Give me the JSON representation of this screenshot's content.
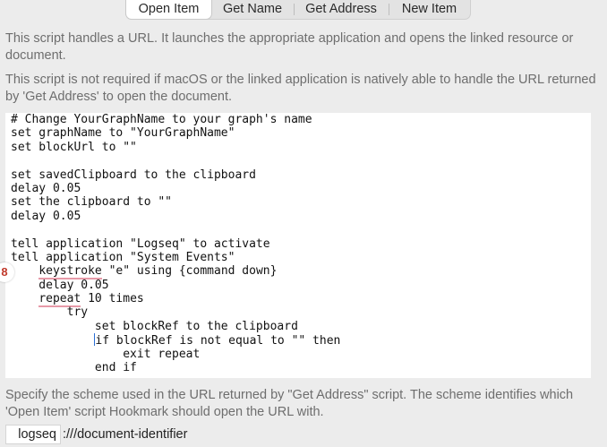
{
  "tabs": [
    {
      "label": "Open Item",
      "active": true
    },
    {
      "label": "Get Name",
      "active": false
    },
    {
      "label": "Get Address",
      "active": false
    },
    {
      "label": "New Item",
      "active": false
    }
  ],
  "description_1": "This script handles a URL. It launches the appropriate application and opens the linked resource or document.",
  "description_2": "This script is not required if macOS or the linked application is natively able to handle the URL returned by 'Get Address' to open the document.",
  "code_lines": [
    "# Change YourGraphName to your graph's name",
    "set graphName to \"YourGraphName\"",
    "set blockUrl to \"\"",
    "",
    "set savedClipboard to the clipboard",
    "delay 0.05",
    "set the clipboard to \"\"",
    "delay 0.05",
    "",
    "tell application \"Logseq\" to activate",
    "tell application \"System Events\"",
    "    keystroke \"e\" using {command down}",
    "    delay 0.05",
    "    repeat 10 times",
    "        try",
    "            set blockRef to the clipboard",
    "            if blockRef is not equal to \"\" then",
    "                exit repeat",
    "            end if"
  ],
  "error_badge": "8",
  "scheme_hint": "Specify the scheme used in the URL returned by \"Get Address\" script. The scheme identifies which 'Open Item' script Hookmark should open the URL with.",
  "scheme": {
    "value": "logseq",
    "suffix": ":///document-identifier"
  },
  "colors": {
    "background": "#ececec",
    "editor_background": "#ffffff",
    "error_badge": "#c0392b",
    "spelling_squiggle": "#e79aa8",
    "caret": "#2a6fd6"
  }
}
